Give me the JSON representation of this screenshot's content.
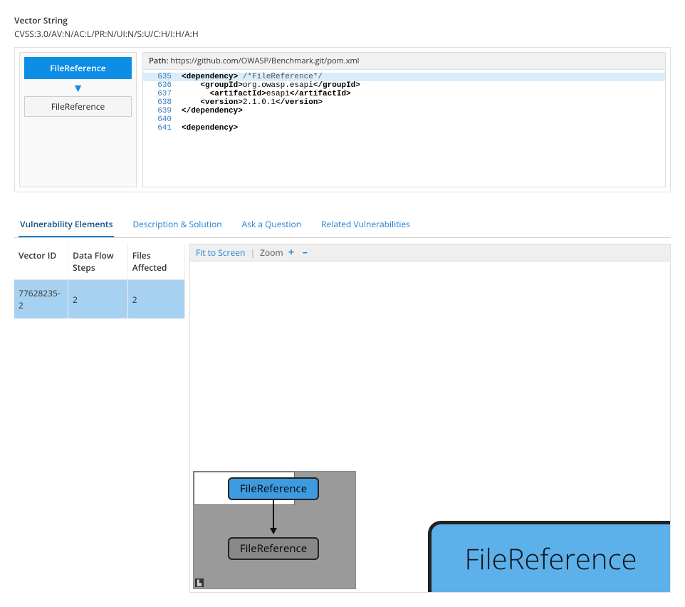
{
  "header": {
    "title": "Vector String",
    "value": "CVSS:3.0/AV:N/AC:L/PR:N/UI:N/S:U/C:H/I:H/A:H"
  },
  "flow": {
    "step1": "FileReference",
    "step2": "FileReference"
  },
  "code": {
    "path_label": "Path:",
    "path_value": "https://github.com/OWASP/Benchmark.git/pom.xml",
    "lines": {
      "l635": "635",
      "c635a": "<dependency>",
      "c635b": " /*FileReference*/",
      "l636": "636",
      "c636a": "<groupId>",
      "c636b": "org.owasp.esapi",
      "c636c": "</groupId>",
      "l637": "637",
      "c637a": "<artifactId>",
      "c637b": "esapi",
      "c637c": "</artifactId>",
      "l638": "638",
      "c638a": "<version>",
      "c638b": "2.1.0.1",
      "c638c": "</version>",
      "l639": "639",
      "c639a": "</dependency>",
      "l640": "640",
      "c640a": "",
      "l641": "641",
      "c641a": "<dependency>"
    }
  },
  "tabs": {
    "t1": "Vulnerability Elements",
    "t2": "Description & Solution",
    "t3": "Ask a Question",
    "t4": "Related Vulnerabilities"
  },
  "table": {
    "h1": "Vector ID",
    "h2": "Data Flow Steps",
    "h3": "Files Affected",
    "r1c1": "77628235-2",
    "r1c2": "2",
    "r1c3": "2"
  },
  "graph": {
    "fit": "Fit to Screen",
    "zoom_label": "Zoom",
    "zoom_in": "+",
    "zoom_out": "–",
    "mm_node1": "FileReference",
    "mm_node2": "FileReference",
    "big_node": "FileReference"
  }
}
